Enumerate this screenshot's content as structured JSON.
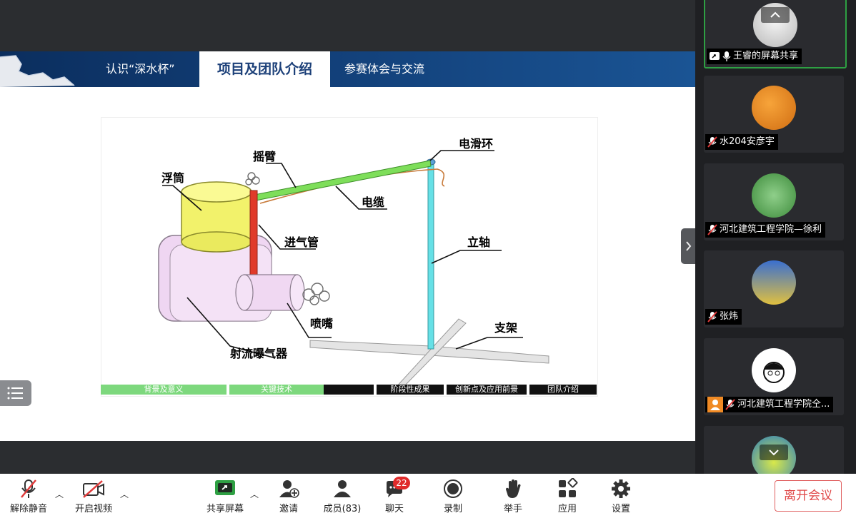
{
  "slide": {
    "tabs": [
      {
        "label": "认识“深水杯”"
      },
      {
        "label": "项目及团队介绍"
      },
      {
        "label": "参赛体会与交流"
      }
    ],
    "figure_labels": {
      "float": "浮筒",
      "rocker": "摇臂",
      "slip_ring": "电滑环",
      "cable": "电缆",
      "intake": "进气管",
      "shaft": "立轴",
      "nozzle": "喷嘴",
      "bracket": "支架",
      "aerator": "射流曝气器"
    },
    "progress_tabs": [
      {
        "label": "背景及意义"
      },
      {
        "label": "关键技术"
      },
      {
        "label": "阶段性成果"
      },
      {
        "label": "创新点及应用前景"
      },
      {
        "label": "团队介绍"
      }
    ]
  },
  "participants": [
    {
      "name": "王睿的屏幕共享"
    },
    {
      "name": "水204安彦宇"
    },
    {
      "name": "河北建筑工程学院—徐利"
    },
    {
      "name": "张炜"
    },
    {
      "name": "河北建筑工程学院仝..."
    },
    {
      "name": ""
    }
  ],
  "toolbar": {
    "unmute": "解除静音",
    "start_video": "开启视频",
    "share_screen": "共享屏幕",
    "invite": "邀请",
    "members": "成员(83)",
    "chat": "聊天",
    "chat_badge": "22",
    "record": "录制",
    "raise_hand": "举手",
    "apps": "应用",
    "settings": "设置",
    "leave": "离开会议"
  },
  "colors": {
    "accent_green": "#2ea043",
    "leave_red": "#e04848",
    "progress_green": "#7dd87d",
    "header_blue": "#123f78"
  }
}
